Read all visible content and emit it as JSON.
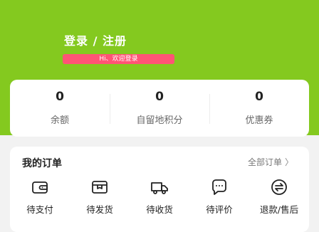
{
  "header": {
    "login_label": "登录 / 注册",
    "welcome_text": "Hi、欢迎登录"
  },
  "stats": [
    {
      "value": "0",
      "label": "余额"
    },
    {
      "value": "0",
      "label": "自留地积分"
    },
    {
      "value": "0",
      "label": "优惠券"
    }
  ],
  "orders": {
    "title": "我的订单",
    "all_label": "全部订单",
    "all_chevron": "〉",
    "items": [
      {
        "label": "待支付",
        "icon": "wallet-icon"
      },
      {
        "label": "待发货",
        "icon": "package-icon"
      },
      {
        "label": "待收货",
        "icon": "truck-icon"
      },
      {
        "label": "待评价",
        "icon": "comment-icon"
      },
      {
        "label": "退款/售后",
        "icon": "exchange-icon"
      }
    ]
  },
  "colors": {
    "brand_green": "#84c91f",
    "welcome_bar": "#ff5475",
    "card_bg": "#ffffff",
    "page_bg": "#f2f2f2"
  }
}
